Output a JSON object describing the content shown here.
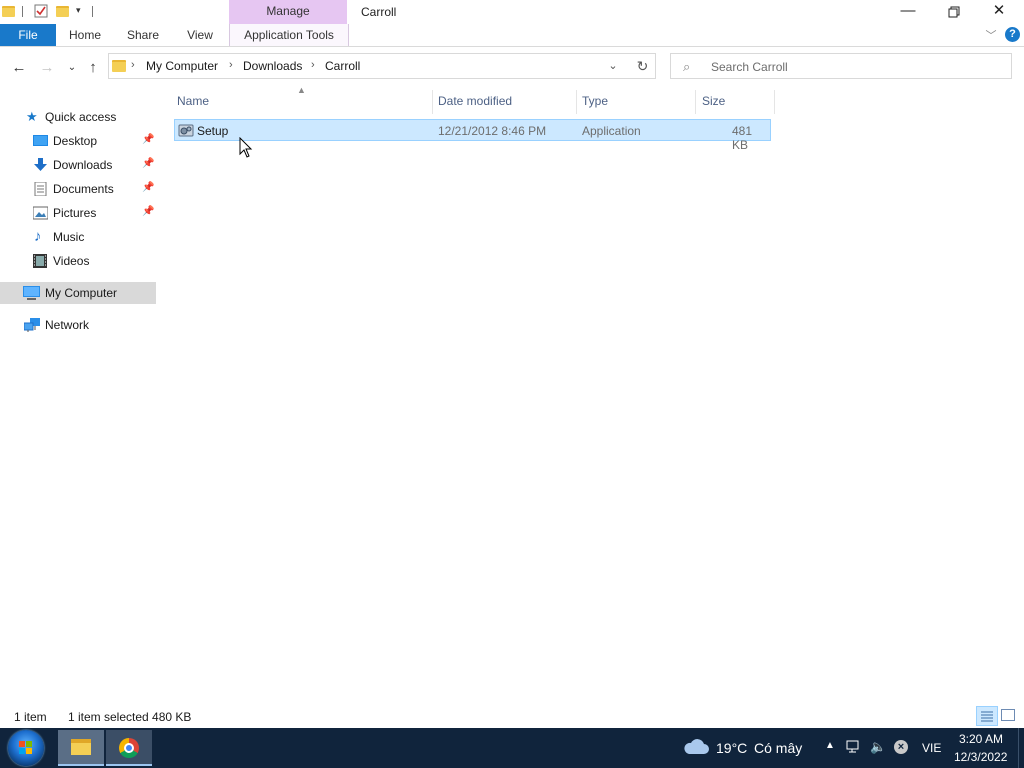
{
  "titlebar": {
    "context_tab": "Manage",
    "title": "Carroll",
    "quick_access_icons": [
      "folder-icon",
      "properties-icon",
      "new-folder-icon",
      "customize-arrow-icon"
    ],
    "window_buttons": [
      "minimize-icon",
      "restore-icon",
      "close-icon"
    ]
  },
  "ribbon": {
    "tabs": [
      "File",
      "Home",
      "Share",
      "View",
      "Application Tools"
    ],
    "file_color": "#1979ca",
    "context_color": "#e6c6f2"
  },
  "address": {
    "crumbs": [
      "My Computer",
      "Downloads",
      "Carroll"
    ]
  },
  "search": {
    "placeholder": "Search Carroll"
  },
  "nav": {
    "items": [
      {
        "label": "Quick access",
        "icon": "star-icon"
      },
      {
        "label": "Desktop",
        "icon": "desktop-icon",
        "pinned": true
      },
      {
        "label": "Downloads",
        "icon": "download-icon",
        "pinned": true
      },
      {
        "label": "Documents",
        "icon": "documents-icon",
        "pinned": true
      },
      {
        "label": "Pictures",
        "icon": "pictures-icon",
        "pinned": true
      },
      {
        "label": "Music",
        "icon": "music-icon"
      },
      {
        "label": "Videos",
        "icon": "videos-icon"
      },
      {
        "label": "My Computer",
        "icon": "computer-icon",
        "selected": true
      },
      {
        "label": "Network",
        "icon": "network-icon"
      }
    ]
  },
  "files": {
    "columns": [
      "Name",
      "Date modified",
      "Type",
      "Size"
    ],
    "rows": [
      {
        "name": "Setup",
        "date": "12/21/2012 8:46 PM",
        "type": "Application",
        "size": "481 KB",
        "icon": "setup-app-icon",
        "selected": true
      }
    ]
  },
  "status": {
    "count": "1 item",
    "selected": "1 item selected  480 KB"
  },
  "taskbar": {
    "weather_temp": "19°C",
    "weather_desc": "Có mây",
    "lang": "VIE",
    "time": "3:20 AM",
    "date": "12/3/2022"
  }
}
